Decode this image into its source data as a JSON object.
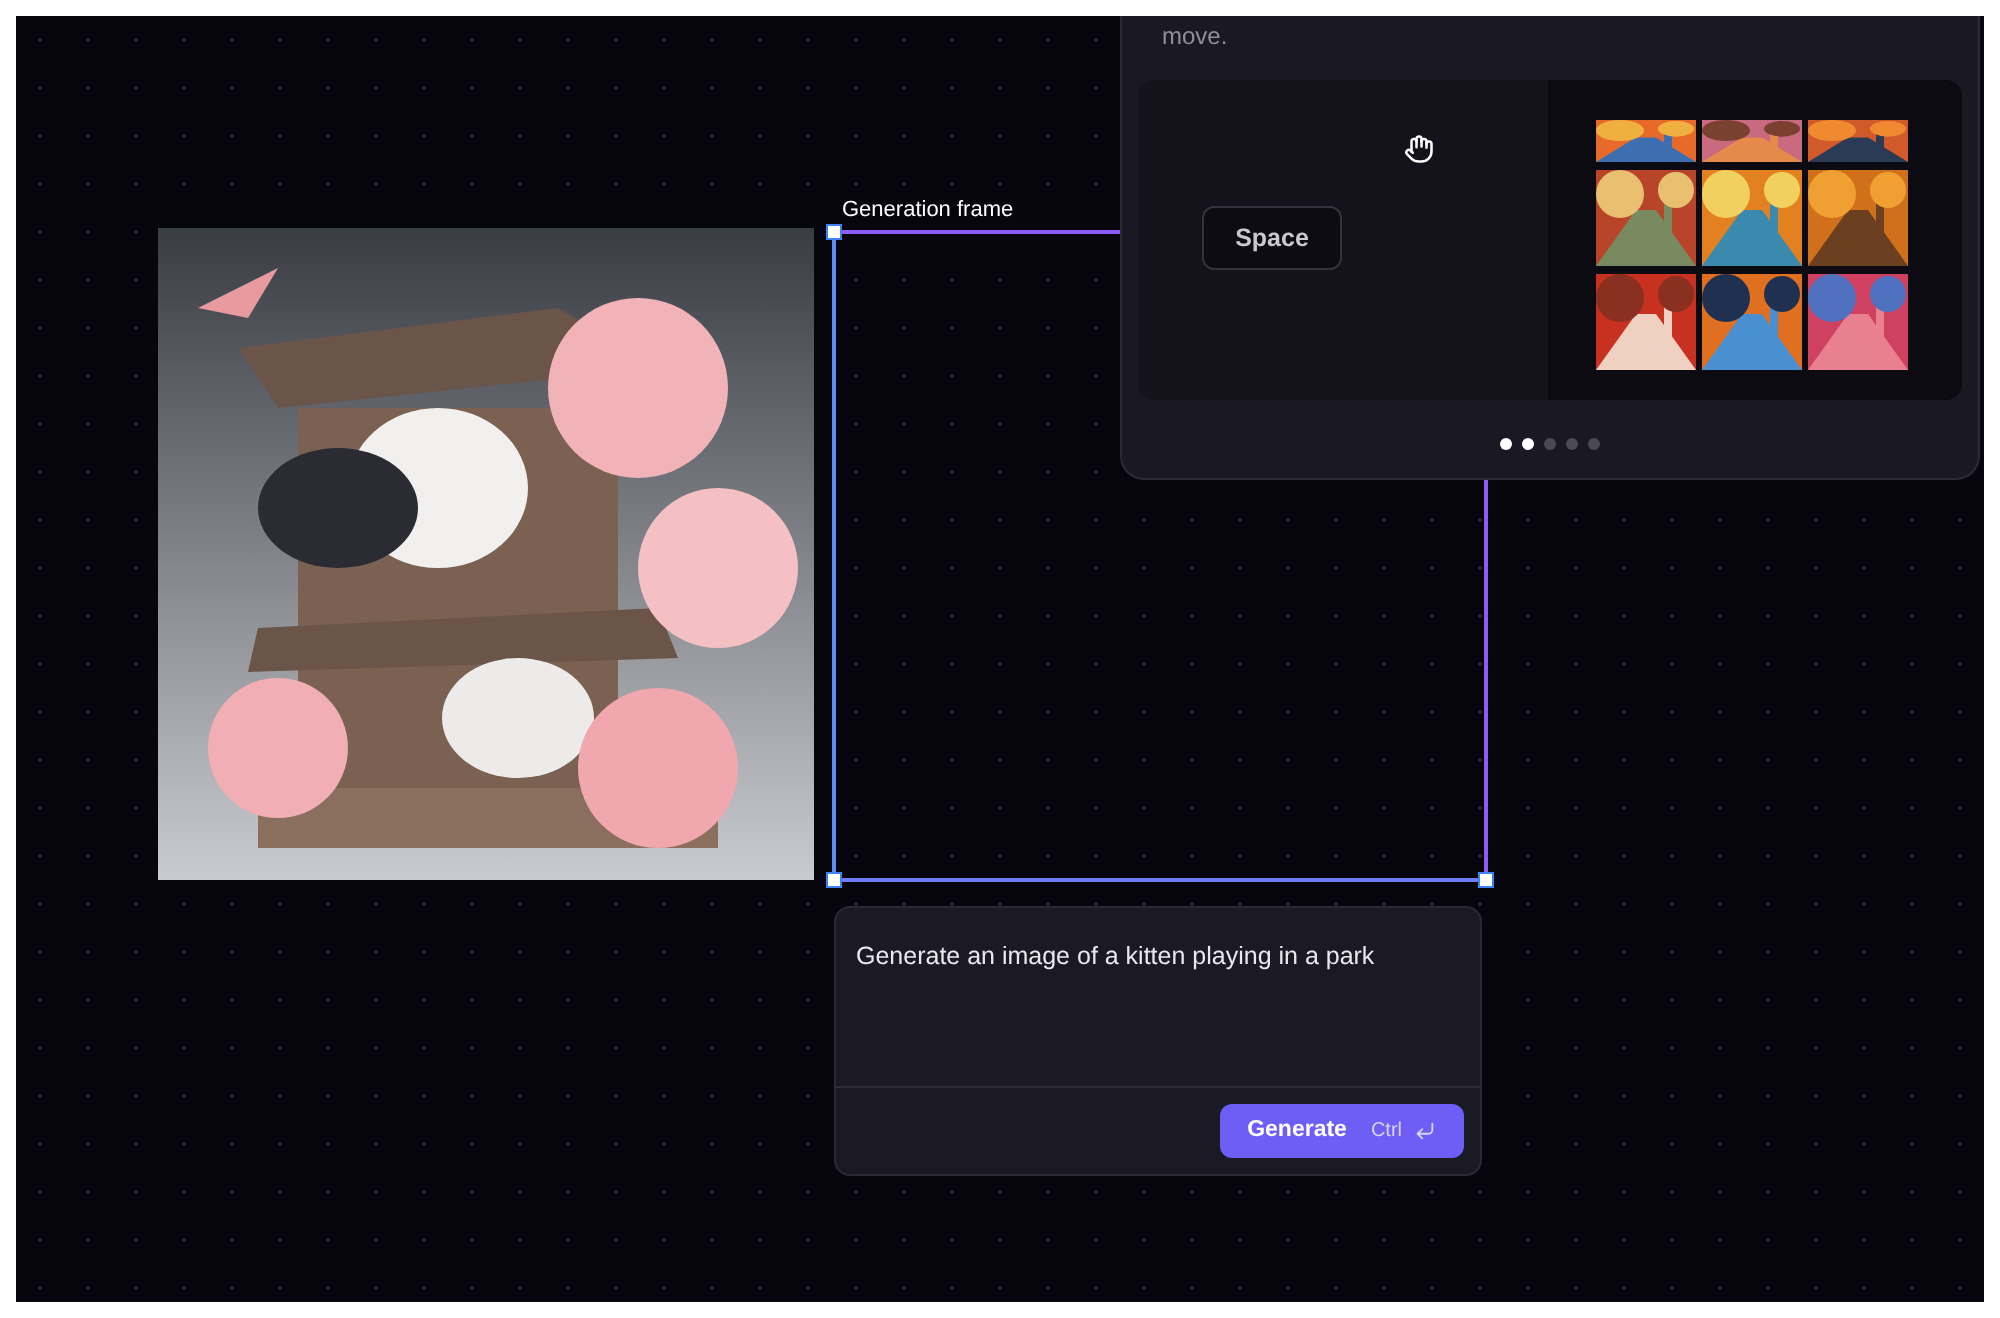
{
  "canvas": {
    "frame_label": "Generation frame"
  },
  "prompt": {
    "value": "Generate an image of a kitten playing in a park",
    "button": "Generate",
    "shortcut": "Ctrl"
  },
  "tip": {
    "text": "move.",
    "key": "Space",
    "dots": [
      {
        "selected": true
      },
      {
        "selected": true
      },
      {
        "selected": false
      },
      {
        "selected": false
      },
      {
        "selected": false
      }
    ]
  }
}
